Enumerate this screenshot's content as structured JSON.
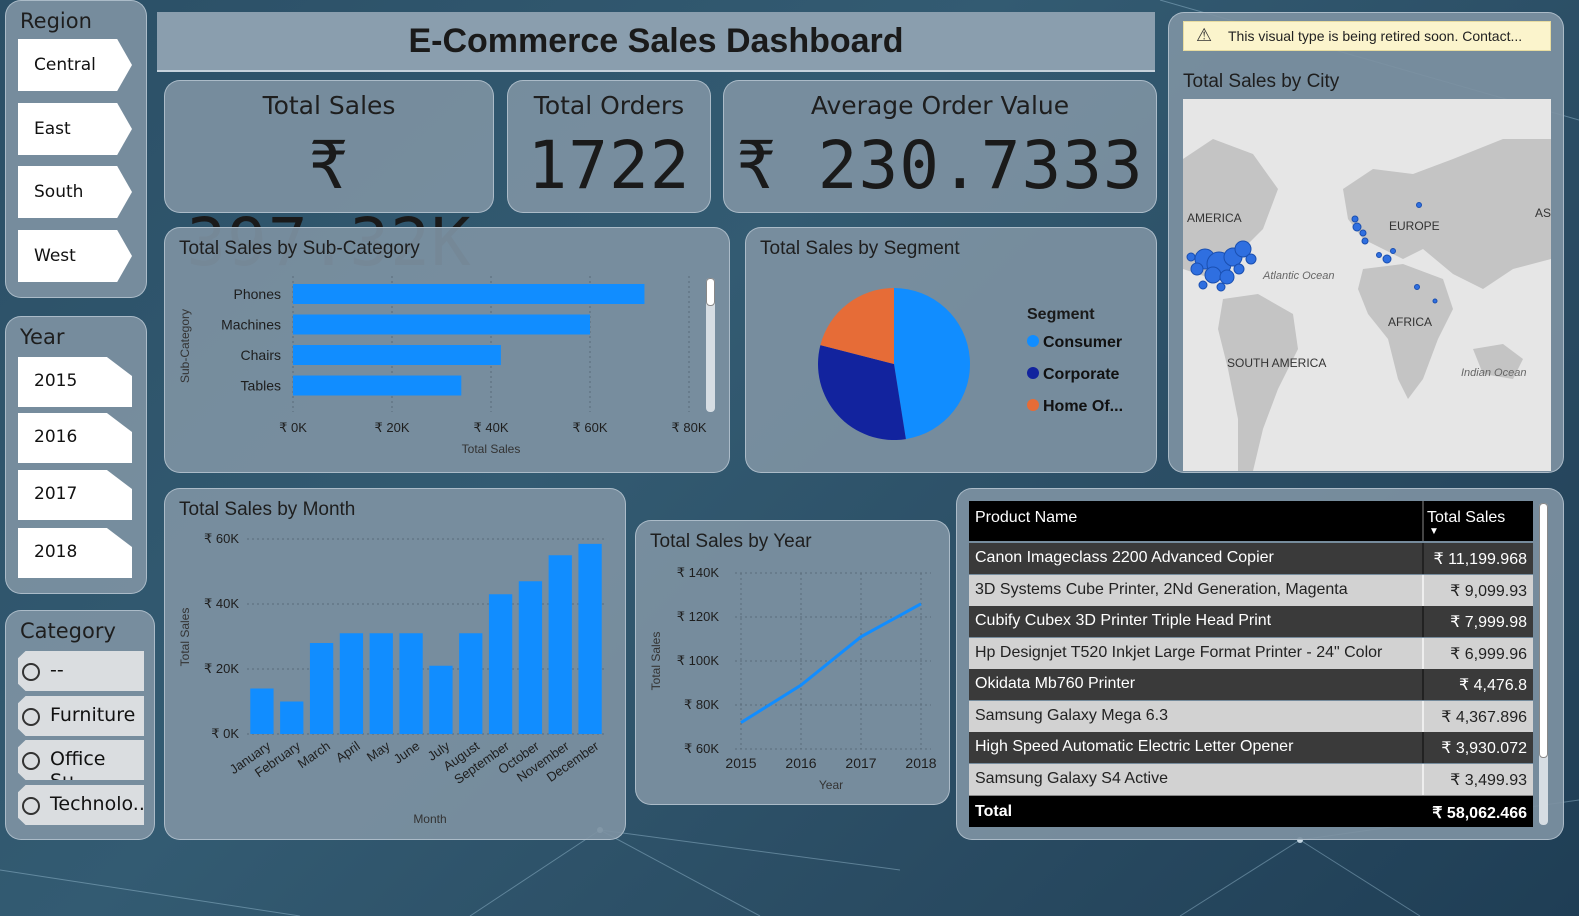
{
  "header": {
    "title": "E-Commerce Sales Dashboard"
  },
  "region": {
    "title": "Region",
    "items": [
      "Central",
      "East",
      "South",
      "West"
    ]
  },
  "year": {
    "title": "Year",
    "items": [
      "2015",
      "2016",
      "2017",
      "2018"
    ]
  },
  "category": {
    "title": "Category",
    "items": [
      "--",
      "Furniture",
      "Office Su...",
      "Technolo..."
    ]
  },
  "kpis": {
    "total_sales": {
      "label": "Total Sales",
      "value": "₹ 397.32K"
    },
    "total_orders": {
      "label": "Total Orders",
      "value": "1722"
    },
    "avg_order": {
      "label": "Average Order Value",
      "value": "₹ 230.7333"
    }
  },
  "map": {
    "warning": "This visual type is being retired soon. Contact...",
    "title": "Total Sales by City",
    "labels": [
      "AMERICA",
      "EUROPE",
      "AS",
      "Atlantic Ocean",
      "AFRICA",
      "SOUTH AMERICA",
      "Indian Ocean"
    ]
  },
  "table": {
    "headers": [
      "Product Name",
      "Total Sales"
    ],
    "rows": [
      [
        "Canon Imageclass 2200 Advanced Copier",
        "₹ 11,199.968"
      ],
      [
        "3D Systems Cube Printer, 2Nd Generation, Magenta",
        "₹ 9,099.93"
      ],
      [
        "Cubify Cubex 3D Printer Triple Head Print",
        "₹ 7,999.98"
      ],
      [
        "Hp Designjet T520 Inkjet Large Format Printer - 24\" Color",
        "₹ 6,999.96"
      ],
      [
        "Okidata Mb760 Printer",
        "₹ 4,476.8"
      ],
      [
        "Samsung Galaxy Mega 6.3",
        "₹ 4,367.896"
      ],
      [
        "High Speed Automatic Electric Letter Opener",
        "₹ 3,930.072"
      ],
      [
        "Samsung Galaxy S4 Active",
        "₹ 3,499.93"
      ]
    ],
    "total": [
      "Total",
      "₹ 58,062.466"
    ]
  },
  "colors": {
    "accent": "#118dff",
    "corporate": "#12239e",
    "home_office": "#e66c37",
    "panel": "#7d91a2"
  },
  "chart_data": [
    {
      "type": "bar",
      "orientation": "horizontal",
      "title": "Total Sales by Sub-Category",
      "xlabel": "Total Sales",
      "ylabel": "Sub-Category",
      "categories": [
        "Phones",
        "Machines",
        "Chairs",
        "Tables"
      ],
      "values": [
        71000,
        60000,
        42000,
        34000
      ],
      "xlim": [
        0,
        80000
      ],
      "ticks": [
        "₹ 0K",
        "₹ 20K",
        "₹ 40K",
        "₹ 60K",
        "₹ 80K"
      ],
      "tick_values": [
        0,
        20000,
        40000,
        60000,
        80000
      ]
    },
    {
      "type": "pie",
      "title": "Total Sales by Segment",
      "legend_title": "Segment",
      "legend": "right",
      "series": [
        {
          "name": "Consumer",
          "value": 47.5,
          "color": "#118dff"
        },
        {
          "name": "Corporate",
          "value": 31.5,
          "color": "#12239e"
        },
        {
          "name": "Home Of...",
          "value": 21,
          "color": "#e66c37"
        }
      ]
    },
    {
      "type": "bar",
      "title": "Total Sales by Month",
      "xlabel": "Month",
      "ylabel": "Total Sales",
      "categories": [
        "January",
        "February",
        "March",
        "April",
        "May",
        "June",
        "July",
        "August",
        "September",
        "October",
        "November",
        "December"
      ],
      "values": [
        14000,
        10000,
        28000,
        31000,
        31000,
        31000,
        21000,
        31000,
        43000,
        47000,
        55000,
        58500
      ],
      "ylim": [
        0,
        60000
      ],
      "ticks": [
        "₹ 0K",
        "₹ 20K",
        "₹ 40K",
        "₹ 60K"
      ],
      "tick_values": [
        0,
        20000,
        40000,
        60000
      ]
    },
    {
      "type": "line",
      "title": "Total Sales by Year",
      "xlabel": "Year",
      "ylabel": "Total Sales",
      "x": [
        "2015",
        "2016",
        "2017",
        "2018"
      ],
      "values": [
        72000,
        89000,
        111000,
        126000
      ],
      "ylim": [
        60000,
        140000
      ],
      "ticks": [
        "₹ 60K",
        "₹ 80K",
        "₹ 100K",
        "₹ 120K",
        "₹ 140K"
      ],
      "tick_values": [
        60000,
        80000,
        100000,
        120000,
        140000
      ]
    }
  ]
}
